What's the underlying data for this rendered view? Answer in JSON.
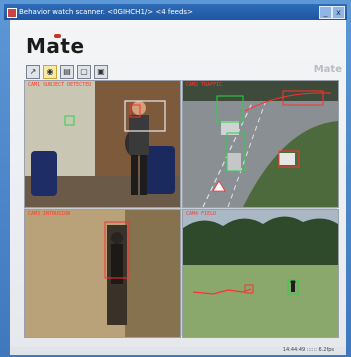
{
  "window": {
    "title": "Behavior watch scanner. <0GIHCH1/> <4 feeds>",
    "controls": [
      "_",
      "x"
    ]
  },
  "brand": {
    "logo_text": "Mate",
    "logo_right": "Mate"
  },
  "toolbar": {
    "buttons": [
      {
        "name": "tool-pointer",
        "glyph": "↗"
      },
      {
        "name": "tool-camera",
        "glyph": "◉"
      },
      {
        "name": "tool-folder",
        "glyph": "▤"
      },
      {
        "name": "tool-monitor",
        "glyph": "▢"
      },
      {
        "name": "tool-settings",
        "glyph": "▣"
      }
    ]
  },
  "feeds": [
    {
      "label": "CAM1  SUBJECT DETECTED"
    },
    {
      "label": "CAM2  TRAFFIC"
    },
    {
      "label": "CAM3  INTRUSION"
    },
    {
      "label": "CAM4  FIELD"
    }
  ],
  "status": {
    "text": "14:44:49  ::::::  6.2fps"
  }
}
